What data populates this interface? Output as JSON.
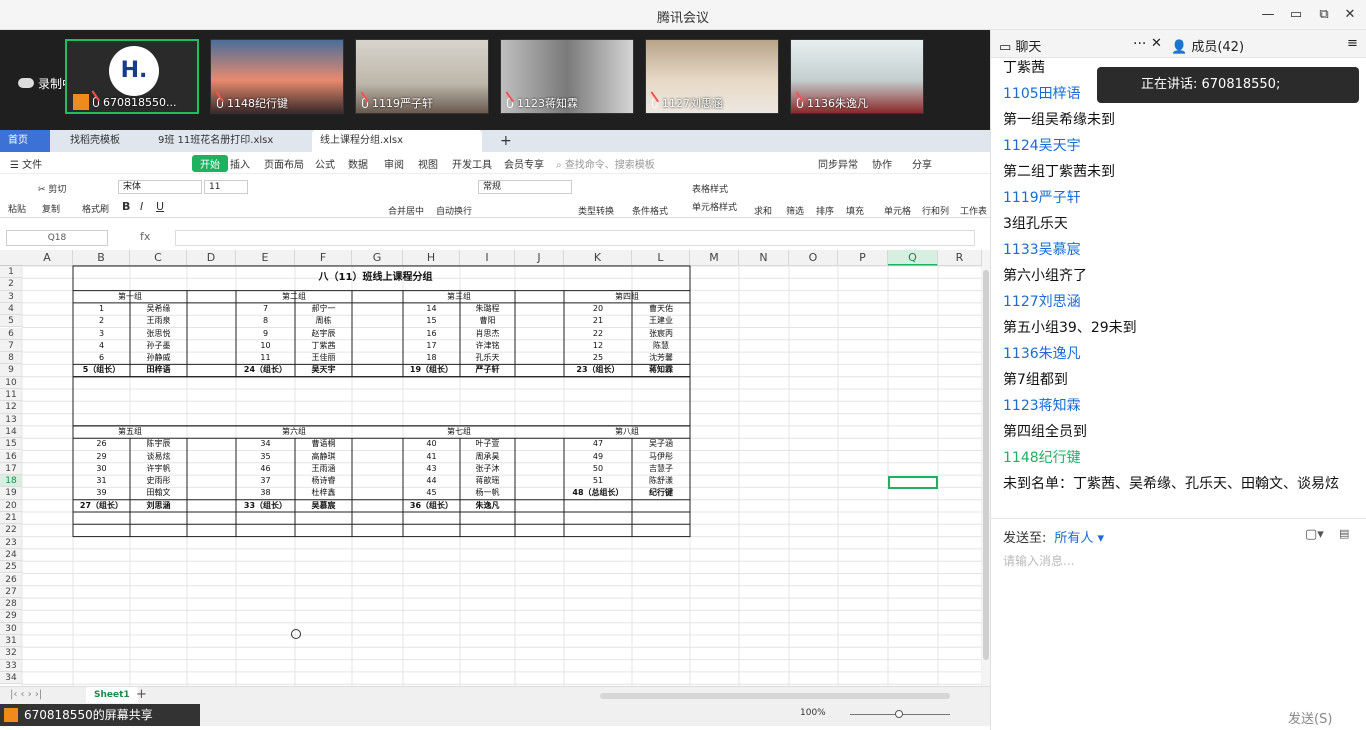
{
  "window": {
    "title": "腾讯会议"
  },
  "video": {
    "recording": "录制中",
    "tiles": [
      {
        "name": "670818550..."
      },
      {
        "name": "1148纪行键"
      },
      {
        "name": "1119严子轩"
      },
      {
        "name": "1123蒋知霖"
      },
      {
        "name": "1127刘思涵"
      },
      {
        "name": "1136朱逸凡"
      }
    ],
    "logo_letter": "H."
  },
  "doc_tabs": [
    "首页",
    "找稻壳模板",
    "9班 11班花名册打印.xlsx",
    "线上课程分组.xlsx"
  ],
  "menu": [
    "文件",
    "开始",
    "插入",
    "页面布局",
    "公式",
    "数据",
    "审阅",
    "视图",
    "开发工具",
    "会员专享",
    "查找命令、搜索模板",
    "同步异常",
    "协作",
    "分享"
  ],
  "ribbon": {
    "paste": "粘贴",
    "cut": "剪切",
    "copy": "复制",
    "format_painter": "格式刷",
    "font": "宋体",
    "size": "11",
    "number_format": "常规",
    "merge": "合并居中",
    "wrap": "自动换行",
    "convert": "类型转换",
    "cond_format": "条件格式",
    "table_style": "表格样式",
    "cell_style": "单元格样式",
    "sum": "求和",
    "filter": "筛选",
    "sort": "排序",
    "fill": "填充",
    "cells": "单元格",
    "rowcol": "行和列",
    "sheet": "工作表"
  },
  "formula": {
    "name_box": "Q18",
    "fx": "fx"
  },
  "columns": [
    "A",
    "B",
    "C",
    "D",
    "E",
    "F",
    "G",
    "H",
    "I",
    "J",
    "K",
    "L",
    "M",
    "N",
    "O",
    "P",
    "Q",
    "R"
  ],
  "sheet": {
    "title": "八（11）班线上课程分组",
    "groups_top": [
      "第一组",
      "第二组",
      "第三组",
      "第四组"
    ],
    "groups_bottom": [
      "第五组",
      "第六组",
      "第七组",
      "第八组"
    ],
    "top_rows": [
      [
        "1",
        "吴希缘",
        "7",
        "郝宁一",
        "14",
        "朱璐程",
        "20",
        "曹天佑"
      ],
      [
        "2",
        "王雨泉",
        "8",
        "周栋",
        "15",
        "曹阳",
        "21",
        "王建业"
      ],
      [
        "3",
        "张思悦",
        "9",
        "赵宇辰",
        "16",
        "肖思杰",
        "22",
        "张宸丙"
      ],
      [
        "4",
        "孙子墨",
        "10",
        "丁紫茜",
        "17",
        "许津铭",
        "12",
        "陈慧"
      ],
      [
        "6",
        "孙静威",
        "11",
        "王佳丽",
        "18",
        "孔乐天",
        "25",
        "沈芳馨"
      ],
      [
        "5（组长）",
        "田梓语",
        "24（组长）",
        "吴天宇",
        "19（组长）",
        "严子轩",
        "23（组长）",
        "蒋知霖"
      ]
    ],
    "bottom_rows": [
      [
        "26",
        "陈宇辰",
        "34",
        "曹语桐",
        "40",
        "叶子萱",
        "47",
        "吴子涵"
      ],
      [
        "29",
        "谈易炫",
        "35",
        "高静琪",
        "41",
        "周承昊",
        "49",
        "马伊彤"
      ],
      [
        "30",
        "许宇帆",
        "46",
        "王雨涵",
        "43",
        "张子沐",
        "50",
        "吉慧子"
      ],
      [
        "31",
        "史雨彤",
        "37",
        "杨诗睿",
        "44",
        "蒋歆瑶",
        "51",
        "陈舒漾"
      ],
      [
        "39",
        "田翰文",
        "38",
        "杜梓鑫",
        "45",
        "杨一帆",
        "48（总组长）",
        "纪行键"
      ],
      [
        "27（组长）",
        "刘思涵",
        "33（组长）",
        "吴慕宸",
        "36（组长）",
        "朱逸凡",
        "",
        ""
      ]
    ],
    "sheet_tab": "Sheet1",
    "zoom": "100%"
  },
  "share": {
    "label": "670818550的屏幕共享"
  },
  "sidebar": {
    "chat_tab": "聊天",
    "members_tab": "成员(42)",
    "speaking": "正在讲话: 670818550;",
    "messages": [
      {
        "text": "丁紫茜",
        "kind": "dark"
      },
      {
        "text": "1105田梓语",
        "kind": "blue"
      },
      {
        "text": "第一组吴希缘未到",
        "kind": "dark"
      },
      {
        "text": "1124吴天宇",
        "kind": "blue"
      },
      {
        "text": "第二组丁紫茜未到",
        "kind": "dark"
      },
      {
        "text": "1119严子轩",
        "kind": "blue"
      },
      {
        "text": "3组孔乐天",
        "kind": "dark"
      },
      {
        "text": "1133吴慕宸",
        "kind": "blue"
      },
      {
        "text": "第六小组齐了",
        "kind": "dark"
      },
      {
        "text": "1127刘思涵",
        "kind": "blue"
      },
      {
        "text": "第五小组39、29未到",
        "kind": "dark"
      },
      {
        "text": "1136朱逸凡",
        "kind": "blue"
      },
      {
        "text": "第7组都到",
        "kind": "dark"
      },
      {
        "text": "1123蒋知霖",
        "kind": "blue"
      },
      {
        "text": "第四组全员到",
        "kind": "dark"
      },
      {
        "text": "1148纪行键",
        "kind": "green"
      },
      {
        "text": "未到名单：丁紫茜、吴希缘、孔乐天、田翰文、谈易炫",
        "kind": "dark"
      }
    ],
    "send_to_label": "发送至:",
    "send_to_value": "所有人",
    "input_placeholder": "请输入消息...",
    "send_button": "发送(S)"
  }
}
